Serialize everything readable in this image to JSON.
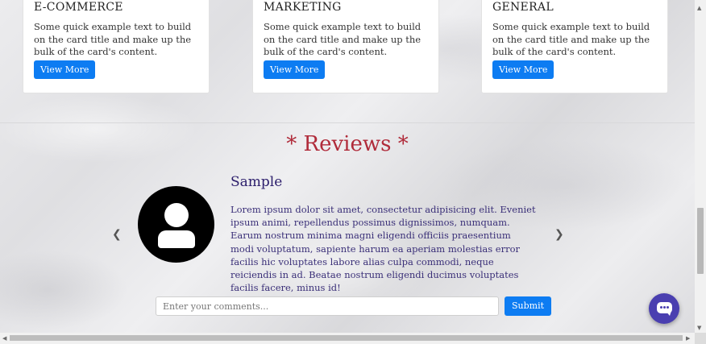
{
  "cards": [
    {
      "title": "E-COMMERCE",
      "text": "Some quick example text to build on the card title and make up the bulk of the card's content.",
      "button": "View More"
    },
    {
      "title": "MARKETING",
      "text": "Some quick example text to build on the card title and make up the bulk of the card's content.",
      "button": "View More"
    },
    {
      "title": "GENERAL",
      "text": "Some quick example text to build on the card title and make up the bulk of the card's content.",
      "button": "View More"
    }
  ],
  "reviews": {
    "heading": "* Reviews *",
    "item": {
      "name": "Sample",
      "text": "Lorem ipsum dolor sit amet, consectetur adipisicing elit. Eveniet ipsum animi, repellendus possimus dignissimos, numquam. Earum nostrum minima magni eligendi officiis praesentium modi voluptatum, sapiente harum ea aperiam molestias error facilis hic voluptates labore alias culpa commodi, neque reiciendis in ad. Beatae nostrum eligendi ducimus voluptates facilis facere, minus id!"
    },
    "prev_icon": "chevron-left-icon",
    "next_icon": "chevron-right-icon"
  },
  "comment": {
    "placeholder": "Enter your comments...",
    "value": "",
    "submit": "Submit"
  },
  "chat": {
    "icon": "chat-bubble-icon"
  },
  "colors": {
    "accent": "#0d7cf2",
    "reviews_heading": "#b02b3a",
    "review_text": "#3a2f78",
    "chat_button": "#4a3fb0"
  }
}
